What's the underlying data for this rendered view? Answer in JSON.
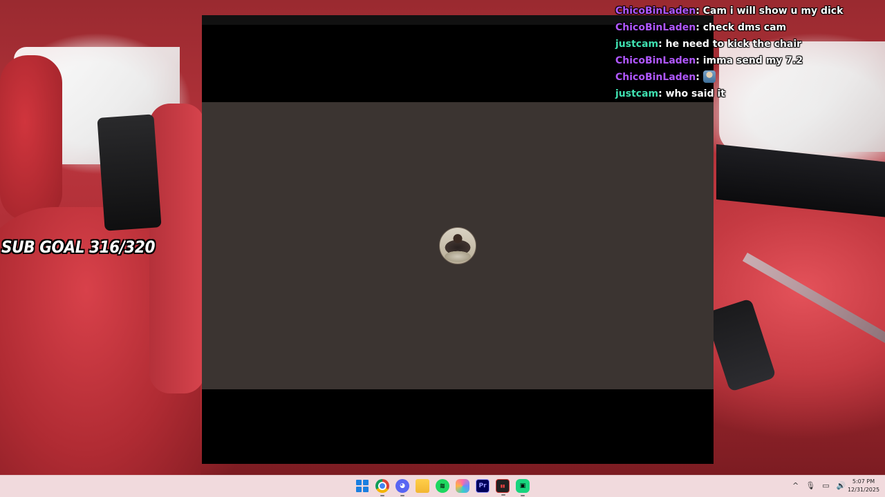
{
  "overlay": {
    "sub_goal": "SUB GOAL 316/320"
  },
  "chat": {
    "messages": [
      {
        "user": "ChicoBinLaden",
        "color": "#b057ff",
        "text": "Cam i will show u my dick"
      },
      {
        "user": "ChicoBinLaden",
        "color": "#b057ff",
        "text": "check dms cam"
      },
      {
        "user": "justcam",
        "color": "#3fe0b0",
        "text": "he need to kick the chair"
      },
      {
        "user": "ChicoBinLaden",
        "color": "#b057ff",
        "text": "imma send my 7.2"
      },
      {
        "user": "ChicoBinLaden",
        "color": "#b057ff",
        "text": "",
        "emote": "person-emote"
      },
      {
        "user": "justcam",
        "color": "#3fe0b0",
        "text": "who said it"
      }
    ]
  },
  "player": {
    "avatar_icon": "user-avatar"
  },
  "taskbar": {
    "apps": [
      {
        "name": "start",
        "icon": "windows-start-icon"
      },
      {
        "name": "chrome",
        "icon": "chrome-icon"
      },
      {
        "name": "discord",
        "icon": "discord-icon"
      },
      {
        "name": "file-explorer",
        "icon": "folder-icon"
      },
      {
        "name": "spotify",
        "icon": "spotify-icon"
      },
      {
        "name": "copilot",
        "icon": "copilot-icon"
      },
      {
        "name": "premiere",
        "icon": "premiere-icon",
        "label": "Pr"
      },
      {
        "name": "movie-app",
        "icon": "movie-icon"
      },
      {
        "name": "green-app",
        "icon": "green-app-icon"
      }
    ],
    "tray": {
      "chevron": "^",
      "time": "5:07 PM",
      "date": "12/31/2025"
    }
  }
}
